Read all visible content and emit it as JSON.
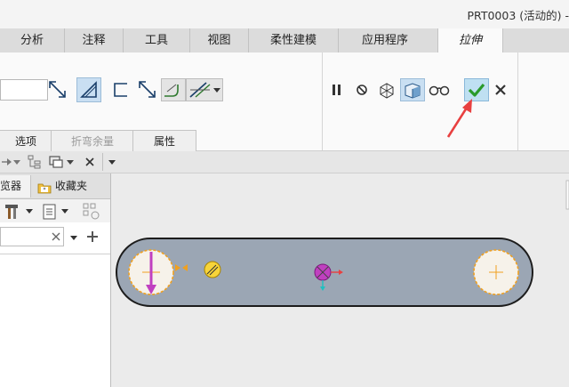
{
  "window": {
    "title": "PRT0003 (活动的) -"
  },
  "ribbon_tabs": [
    {
      "label": "分析"
    },
    {
      "label": "注释"
    },
    {
      "label": "工具"
    },
    {
      "label": "视图"
    },
    {
      "label": "柔性建模"
    },
    {
      "label": "应用程序"
    },
    {
      "label": "拉伸"
    }
  ],
  "dashboard": {
    "tabs": [
      {
        "label": "选项"
      },
      {
        "label": "折弯余量"
      },
      {
        "label": "属性"
      }
    ],
    "depth_value": "",
    "actions": {
      "pause": "pause-icon",
      "no_preview": "no-preview-icon",
      "verify": "verify-icon",
      "preview": "preview-icon",
      "glasses": "glasses-icon",
      "ok": "checkmark-icon",
      "cancel": "close-icon"
    }
  },
  "navigator": {
    "tabs": [
      {
        "label": "览器"
      },
      {
        "label": "收藏夹"
      }
    ],
    "search_value": ""
  },
  "colors": {
    "sketch_fill": "#9ba6b4",
    "hole_fill": "#f6f2ea",
    "highlight_edge": "#f0a020",
    "ok_green": "#2a9a2a",
    "arrow_red": "#e84040",
    "dimension_magenta": "#c040c0"
  }
}
